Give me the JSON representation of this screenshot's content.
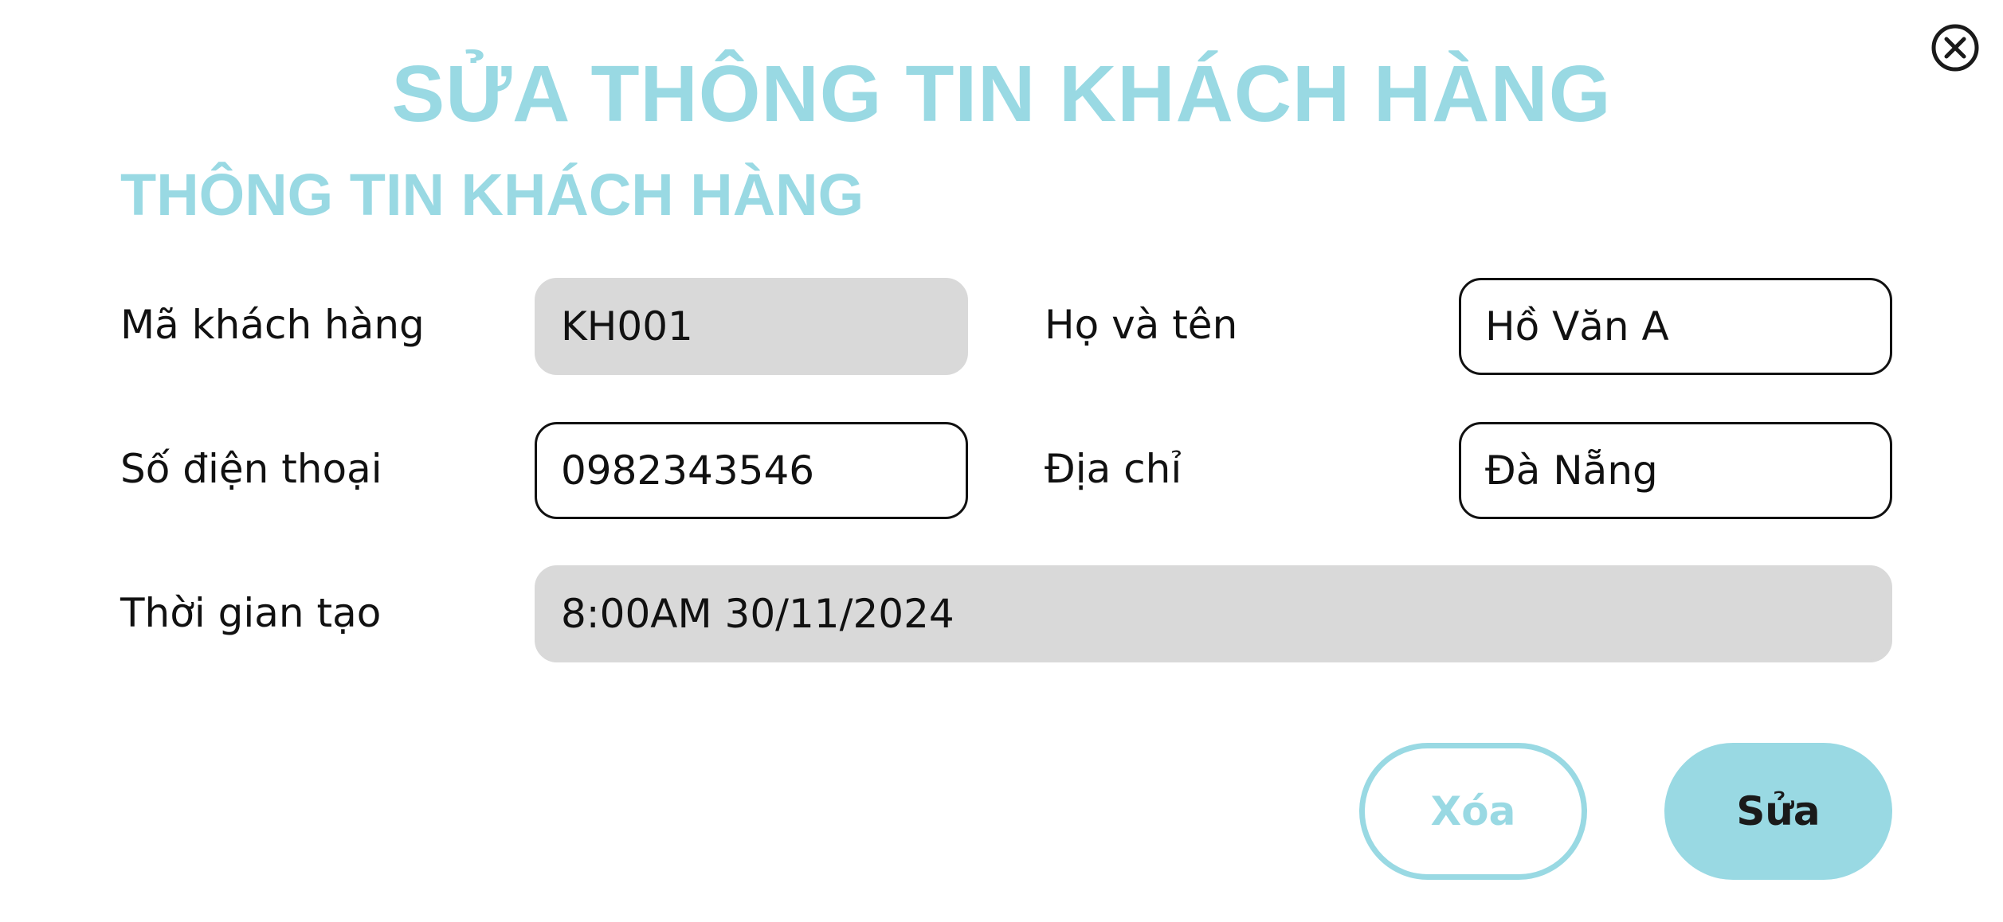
{
  "dialog": {
    "title": "SỬA THÔNG TIN KHÁCH HÀNG",
    "close_icon": "close-circle-icon"
  },
  "section": {
    "title": "THÔNG TIN KHÁCH HÀNG"
  },
  "fields": {
    "customer_id": {
      "label": "Mã khách hàng",
      "value": "KH001",
      "editable": false
    },
    "full_name": {
      "label": "Họ và tên",
      "value": "Hồ Văn A",
      "editable": true
    },
    "phone": {
      "label": "Số điện thoại",
      "value": "0982343546",
      "editable": true
    },
    "address": {
      "label": "Địa chỉ",
      "value": "Đà Nẵng",
      "editable": true
    },
    "created_at": {
      "label": "Thời gian tạo",
      "value": "8:00AM 30/11/2024",
      "editable": false
    }
  },
  "actions": {
    "delete_label": "Xóa",
    "edit_label": "Sửa"
  },
  "colors": {
    "accent": "#99d9e3",
    "readonly_bg": "#d9d9d9",
    "text": "#111111"
  }
}
